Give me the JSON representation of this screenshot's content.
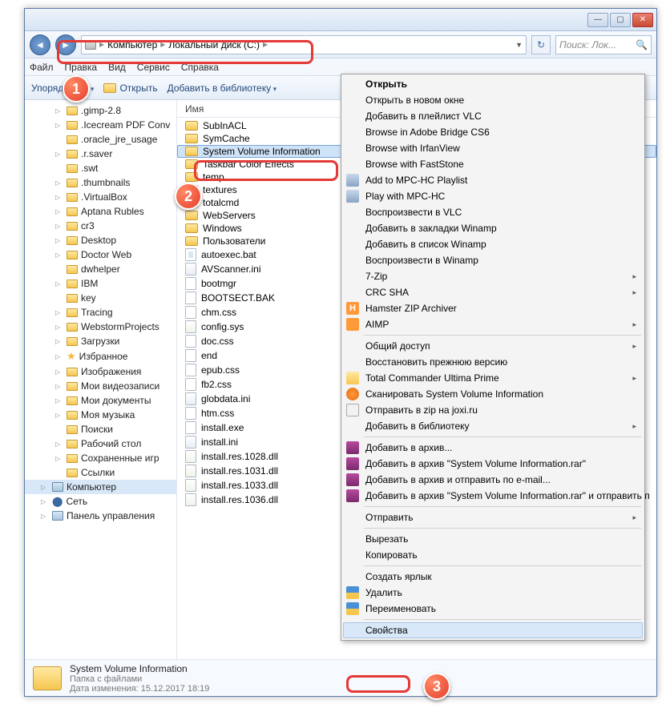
{
  "titlebar": {
    "min": "—",
    "max": "▢",
    "close": "✕"
  },
  "breadcrumb": {
    "computer": "Компьютер",
    "disk": "Локальный диск (C:)"
  },
  "search": {
    "placeholder": "Поиск: Лок...",
    "icon": "🔍"
  },
  "menubar": {
    "file": "Файл",
    "edit": "Правка",
    "view": "Вид",
    "tools": "Сервис",
    "help": "Справка"
  },
  "toolbar": {
    "organize": "Упорядочить",
    "open": "Открыть",
    "library": "Добавить в библиотеку"
  },
  "tree": [
    {
      "label": ".gimp-2.8",
      "icon": "folder",
      "arr": "▷"
    },
    {
      "label": ".Icecream PDF Conv",
      "icon": "folder",
      "arr": "▷"
    },
    {
      "label": ".oracle_jre_usage",
      "icon": "folder",
      "arr": ""
    },
    {
      "label": ".r.saver",
      "icon": "folder",
      "arr": "▷"
    },
    {
      "label": ".swt",
      "icon": "folder",
      "arr": ""
    },
    {
      "label": ".thumbnails",
      "icon": "folder",
      "arr": "▷"
    },
    {
      "label": ".VirtualBox",
      "icon": "folder",
      "arr": "▷"
    },
    {
      "label": "Aptana Rubles",
      "icon": "folder",
      "arr": "▷"
    },
    {
      "label": "cr3",
      "icon": "folder",
      "arr": "▷"
    },
    {
      "label": "Desktop",
      "icon": "folder",
      "arr": "▷"
    },
    {
      "label": "Doctor Web",
      "icon": "folder",
      "arr": "▷"
    },
    {
      "label": "dwhelper",
      "icon": "folder",
      "arr": ""
    },
    {
      "label": "IBM",
      "icon": "folder",
      "arr": "▷"
    },
    {
      "label": "key",
      "icon": "folder",
      "arr": ""
    },
    {
      "label": "Tracing",
      "icon": "folder",
      "arr": "▷"
    },
    {
      "label": "WebstormProjects",
      "icon": "folder",
      "arr": "▷"
    },
    {
      "label": "Загрузки",
      "icon": "folder",
      "arr": "▷"
    },
    {
      "label": "Избранное",
      "icon": "fav",
      "arr": "▷"
    },
    {
      "label": "Изображения",
      "icon": "folder",
      "arr": "▷"
    },
    {
      "label": "Мои видеозаписи",
      "icon": "folder",
      "arr": "▷"
    },
    {
      "label": "Мои документы",
      "icon": "folder",
      "arr": "▷"
    },
    {
      "label": "Моя музыка",
      "icon": "folder",
      "arr": "▷"
    },
    {
      "label": "Поиски",
      "icon": "folder",
      "arr": ""
    },
    {
      "label": "Рабочий стол",
      "icon": "folder",
      "arr": "▷"
    },
    {
      "label": "Сохраненные игр",
      "icon": "folder",
      "arr": "▷"
    },
    {
      "label": "Ссылки",
      "icon": "folder",
      "arr": ""
    },
    {
      "label": "Компьютер",
      "icon": "pc",
      "arr": "▷",
      "lvl": 1,
      "sel": true
    },
    {
      "label": "Сеть",
      "icon": "net",
      "arr": "▷",
      "lvl": 1
    },
    {
      "label": "Панель управления",
      "icon": "pc",
      "arr": "▷",
      "lvl": 1
    }
  ],
  "filelist": {
    "header": "Имя",
    "items": [
      {
        "label": "SubInACL",
        "icon": "folder"
      },
      {
        "label": "SymCache",
        "icon": "folder"
      },
      {
        "label": "System Volume Information",
        "icon": "folder",
        "sel": true
      },
      {
        "label": "Taskbar Color Effects",
        "icon": "folder"
      },
      {
        "label": "temp",
        "icon": "folder"
      },
      {
        "label": "textures",
        "icon": "folder"
      },
      {
        "label": "totalcmd",
        "icon": "folder"
      },
      {
        "label": "WebServers",
        "icon": "folder"
      },
      {
        "label": "Windows",
        "icon": "folder"
      },
      {
        "label": "Пользователи",
        "icon": "folder"
      },
      {
        "label": "autoexec.bat",
        "icon": "bat"
      },
      {
        "label": "AVScanner.ini",
        "icon": "ini"
      },
      {
        "label": "bootmgr",
        "icon": "file"
      },
      {
        "label": "BOOTSECT.BAK",
        "icon": "file"
      },
      {
        "label": "chm.css",
        "icon": "file"
      },
      {
        "label": "config.sys",
        "icon": "cfg"
      },
      {
        "label": "doc.css",
        "icon": "file"
      },
      {
        "label": "end",
        "icon": "file"
      },
      {
        "label": "epub.css",
        "icon": "file"
      },
      {
        "label": "fb2.css",
        "icon": "file"
      },
      {
        "label": "globdata.ini",
        "icon": "ini"
      },
      {
        "label": "htm.css",
        "icon": "file"
      },
      {
        "label": "install.exe",
        "icon": "file"
      },
      {
        "label": "install.ini",
        "icon": "ini"
      },
      {
        "label": "install.res.1028.dll",
        "icon": "cfg"
      },
      {
        "label": "install.res.1031.dll",
        "icon": "cfg"
      },
      {
        "label": "install.res.1033.dll",
        "icon": "cfg"
      },
      {
        "label": "install.res.1036.dll",
        "icon": "cfg"
      }
    ]
  },
  "context": [
    {
      "label": "Открыть",
      "bold": true
    },
    {
      "label": "Открыть в новом окне"
    },
    {
      "label": "Добавить в плейлист VLC"
    },
    {
      "label": "Browse in Adobe Bridge CS6"
    },
    {
      "label": "Browse with IrfanView"
    },
    {
      "label": "Browse with FastStone"
    },
    {
      "label": "Add to MPC-HC Playlist",
      "icon": "mpc"
    },
    {
      "label": "Play with MPC-HC",
      "icon": "mpc"
    },
    {
      "label": "Воспроизвести в VLC"
    },
    {
      "label": "Добавить в закладки Winamp"
    },
    {
      "label": "Добавить в список Winamp"
    },
    {
      "label": "Воспроизвести в Winamp"
    },
    {
      "label": "7-Zip",
      "sub": true
    },
    {
      "label": "CRC SHA",
      "sub": true
    },
    {
      "label": "Hamster ZIP Archiver",
      "icon": "h"
    },
    {
      "label": "AIMP",
      "icon": "aimp",
      "sub": true
    },
    {
      "sep": true
    },
    {
      "label": "Общий доступ",
      "sub": true
    },
    {
      "label": "Восстановить прежнюю версию"
    },
    {
      "label": "Total Commander Ultima Prime",
      "icon": "tc",
      "sub": true
    },
    {
      "label": "Сканировать System Volume Information",
      "icon": "avast"
    },
    {
      "label": "Отправить в zip на joxi.ru",
      "icon": "joxi"
    },
    {
      "label": "Добавить в библиотеку",
      "sub": true
    },
    {
      "sep": true
    },
    {
      "label": "Добавить в архив...",
      "icon": "rar"
    },
    {
      "label": "Добавить в архив \"System Volume Information.rar\"",
      "icon": "rar"
    },
    {
      "label": "Добавить в архив и отправить по e-mail...",
      "icon": "rar"
    },
    {
      "label": "Добавить в архив \"System Volume Information.rar\" и отправить п",
      "icon": "rar"
    },
    {
      "sep": true
    },
    {
      "label": "Отправить",
      "sub": true
    },
    {
      "sep": true
    },
    {
      "label": "Вырезать"
    },
    {
      "label": "Копировать"
    },
    {
      "sep": true
    },
    {
      "label": "Создать ярлык"
    },
    {
      "label": "Удалить",
      "icon": "shield"
    },
    {
      "label": "Переименовать",
      "icon": "shield"
    },
    {
      "sep": true
    },
    {
      "label": "Свойства",
      "sel": true
    }
  ],
  "status": {
    "name": "System Volume Information",
    "type": "Папка с файлами",
    "date_label": "Дата изменения:",
    "date": "15.12.2017 18:19"
  },
  "bubbles": {
    "b1": "1",
    "b2": "2",
    "b3": "3"
  }
}
